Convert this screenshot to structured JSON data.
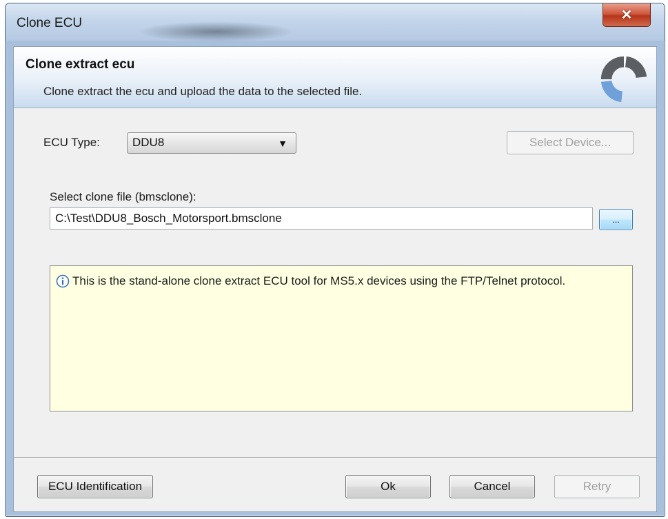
{
  "window": {
    "title": "Clone ECU",
    "close_label": "✕"
  },
  "header": {
    "title": "Clone extract ecu",
    "subtitle": "Clone extract the ecu and upload the data to the selected file.",
    "logo_icon": "spinner-logo-icon"
  },
  "form": {
    "ecu_type_label": "ECU Type:",
    "ecu_type_value": "DDU8",
    "select_device_label": "Select Device...",
    "clone_file_label": "Select clone file (bmsclone):",
    "clone_file_value": "C:\\Test\\DDU8_Bosch_Motorsport.bmsclone",
    "browse_label": "..."
  },
  "info": {
    "icon": "info-icon",
    "text": "This is the stand-alone clone extract ECU tool for MS5.x devices using the FTP/Telnet protocol."
  },
  "footer": {
    "ecu_identification_label": "ECU Identification",
    "ok_label": "Ok",
    "cancel_label": "Cancel",
    "retry_label": "Retry"
  },
  "colors": {
    "info_background": "#ffffe1",
    "close_button": "#c7432a",
    "header_gradient_end": "#c9dbee",
    "logo_dark": "#5b5e63",
    "logo_blue": "#6fa0d8"
  }
}
